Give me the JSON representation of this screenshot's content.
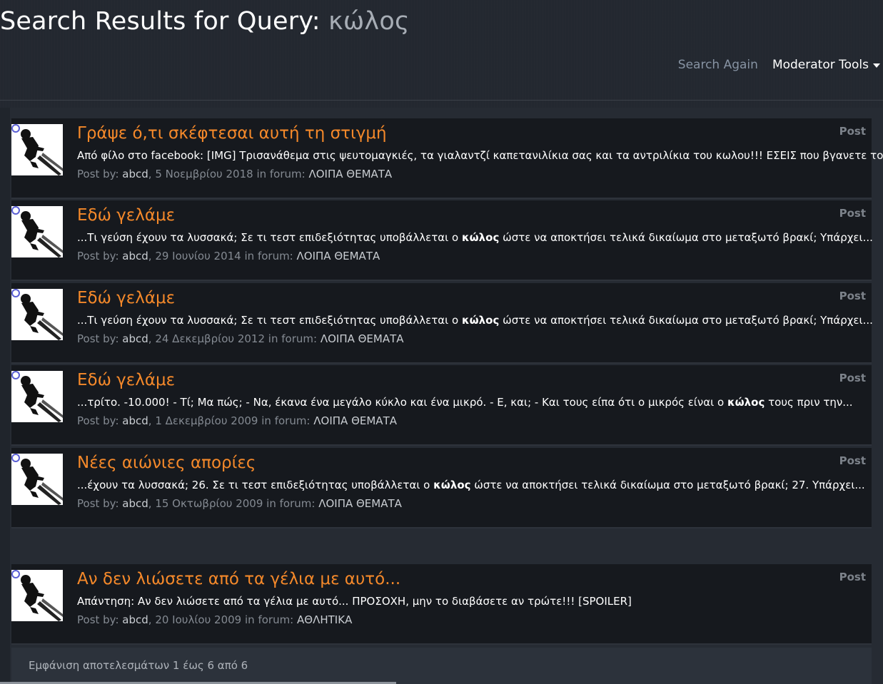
{
  "header": {
    "title_prefix": "Search Results for Query:",
    "query": "κώλος",
    "search_again": "Search Again",
    "moderator_tools": "Moderator Tools"
  },
  "results": [
    {
      "title": "Γράψε ό,τι σκέφτεσαι αυτή τη στιγμή",
      "type": "Post",
      "snippet_parts": [
        "Από φίλο στο facebook: [IMG] Τρισανάθεμα στις ψευτομαγκιές, τα γιαλαντζί καπετανιλίκια σας και τα αντριλίκια του κωλου!!! ΕΣΕΙΣ που βγανετε το..."
      ],
      "post_by_label": "Post by:",
      "author": "abcd",
      "date": "5 Νοεμβρίου 2018",
      "in_forum_label": "in forum:",
      "forum": "ΛΟΙΠΑ ΘΕΜΑΤΑ"
    },
    {
      "title": "Εδώ γελάμε",
      "type": "Post",
      "snippet_before": "...Τι γεύση έχουν τα λυσσακά; Σε τι τεστ επιδεξιότητας υποβάλλεται ο ",
      "snippet_bold": "κώλος",
      "snippet_after": " ώστε να αποκτήσει τελικά δικαίωμα στο μεταξωτό βρακί; Υπάρχει...",
      "post_by_label": "Post by:",
      "author": "abcd",
      "date": "29 Ιουνίου 2014",
      "in_forum_label": "in forum:",
      "forum": "ΛΟΙΠΑ ΘΕΜΑΤΑ"
    },
    {
      "title": "Εδώ γελάμε",
      "type": "Post",
      "snippet_before": "...Τι γεύση έχουν τα λυσσακά; Σε τι τεστ επιδεξιότητας υποβάλλεται ο ",
      "snippet_bold": "κώλος",
      "snippet_after": " ώστε να αποκτήσει τελικά δικαίωμα στο μεταξωτό βρακί; Υπάρχει...",
      "post_by_label": "Post by:",
      "author": "abcd",
      "date": "24 Δεκεμβρίου 2012",
      "in_forum_label": "in forum:",
      "forum": "ΛΟΙΠΑ ΘΕΜΑΤΑ"
    },
    {
      "title": "Εδώ γελάμε",
      "type": "Post",
      "snippet_before": "...τρίτο. -10.000! - Τί; Μα πώς; - Να, έκανα ένα μεγάλο κύκλο και ένα μικρό. - Ε, και; - Και τους είπα ότι ο μικρός είναι ο ",
      "snippet_bold": "κώλος",
      "snippet_after": " τους πριν την...",
      "post_by_label": "Post by:",
      "author": "abcd",
      "date": "1 Δεκεμβρίου 2009",
      "in_forum_label": "in forum:",
      "forum": "ΛΟΙΠΑ ΘΕΜΑΤΑ"
    },
    {
      "title": "Νέες αιώνιες απορίες",
      "type": "Post",
      "snippet_before": "...έχουν τα λυσσακά; 26. Σε τι τεστ επιδεξιότητας υποβάλλεται ο ",
      "snippet_bold": "κώλος",
      "snippet_after": " ώστε να αποκτήσει τελικά δικαίωμα στο μεταξωτό βρακί; 27. Υπάρχει...",
      "post_by_label": "Post by:",
      "author": "abcd",
      "date": "15 Οκτωβρίου 2009",
      "in_forum_label": "in forum:",
      "forum": "ΛΟΙΠΑ ΘΕΜΑΤΑ"
    },
    {
      "title": "Αν δεν λιώσετε από τα γέλια με αυτό...",
      "type": "Post",
      "snippet_parts": [
        "Απάντηση: Αν δεν λιώσετε από τα γέλια με αυτό... ΠΡΟΣΟΧΗ, μην το διαβάσετε αν τρώτε!!! [SPOILER]"
      ],
      "post_by_label": "Post by:",
      "author": "abcd",
      "date": "20 Ιουλίου 2009",
      "in_forum_label": "in forum:",
      "forum": "ΑΘΛΗΤΙΚΑ"
    }
  ],
  "footer": {
    "summary": "Εμφάνιση αποτελεσμάτων 1 έως 6 από 6"
  },
  "colors": {
    "title_accent": "#f5892a",
    "background": "#232830",
    "card": "#16191e"
  }
}
